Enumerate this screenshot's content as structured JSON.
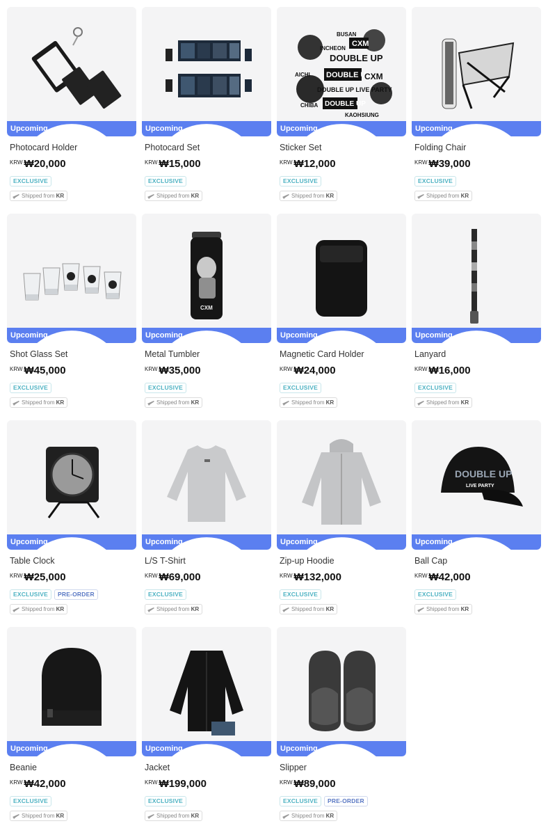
{
  "products": [
    {
      "name": "Photocard Holder",
      "currency": "KRW",
      "price": "₩20,000",
      "status": "Upcoming",
      "tags": [
        "EXCLUSIVE"
      ],
      "shipping_prefix": "Shipped from",
      "shipping_origin": "KR",
      "image": "photocard-holder"
    },
    {
      "name": "Photocard Set",
      "currency": "KRW",
      "price": "₩15,000",
      "status": "Upcoming",
      "tags": [
        "EXCLUSIVE"
      ],
      "shipping_prefix": "Shipped from",
      "shipping_origin": "KR",
      "image": "photocard-set"
    },
    {
      "name": "Sticker Set",
      "currency": "KRW",
      "price": "₩12,000",
      "status": "Upcoming",
      "tags": [
        "EXCLUSIVE"
      ],
      "shipping_prefix": "Shipped from",
      "shipping_origin": "KR",
      "image": "sticker-set"
    },
    {
      "name": "Folding Chair",
      "currency": "KRW",
      "price": "₩39,000",
      "status": "Upcoming",
      "tags": [
        "EXCLUSIVE"
      ],
      "shipping_prefix": "Shipped from",
      "shipping_origin": "KR",
      "image": "folding-chair"
    },
    {
      "name": "Shot Glass Set",
      "currency": "KRW",
      "price": "₩45,000",
      "status": "Upcoming",
      "tags": [
        "EXCLUSIVE"
      ],
      "shipping_prefix": "Shipped from",
      "shipping_origin": "KR",
      "image": "shot-glass-set"
    },
    {
      "name": "Metal Tumbler",
      "currency": "KRW",
      "price": "₩35,000",
      "status": "Upcoming",
      "tags": [
        "EXCLUSIVE"
      ],
      "shipping_prefix": "Shipped from",
      "shipping_origin": "KR",
      "image": "metal-tumbler"
    },
    {
      "name": "Magnetic Card Holder",
      "currency": "KRW",
      "price": "₩24,000",
      "status": "Upcoming",
      "tags": [
        "EXCLUSIVE"
      ],
      "shipping_prefix": "Shipped from",
      "shipping_origin": "KR",
      "image": "magnetic-card-holder"
    },
    {
      "name": "Lanyard",
      "currency": "KRW",
      "price": "₩16,000",
      "status": "Upcoming",
      "tags": [
        "EXCLUSIVE"
      ],
      "shipping_prefix": "Shipped from",
      "shipping_origin": "KR",
      "image": "lanyard"
    },
    {
      "name": "Table Clock",
      "currency": "KRW",
      "price": "₩25,000",
      "status": "Upcoming",
      "tags": [
        "EXCLUSIVE",
        "PRE-ORDER"
      ],
      "shipping_prefix": "Shipped from",
      "shipping_origin": "KR",
      "image": "table-clock"
    },
    {
      "name": "L/S T-Shirt",
      "currency": "KRW",
      "price": "₩69,000",
      "status": "Upcoming",
      "tags": [
        "EXCLUSIVE"
      ],
      "shipping_prefix": "Shipped from",
      "shipping_origin": "KR",
      "image": "ls-tshirt"
    },
    {
      "name": "Zip-up Hoodie",
      "currency": "KRW",
      "price": "₩132,000",
      "status": "Upcoming",
      "tags": [
        "EXCLUSIVE"
      ],
      "shipping_prefix": "Shipped from",
      "shipping_origin": "KR",
      "image": "zip-up-hoodie"
    },
    {
      "name": "Ball Cap",
      "currency": "KRW",
      "price": "₩42,000",
      "status": "Upcoming",
      "tags": [
        "EXCLUSIVE"
      ],
      "shipping_prefix": "Shipped from",
      "shipping_origin": "KR",
      "image": "ball-cap",
      "image_text": [
        "DOUBLE UP",
        "LIVE PARTY"
      ]
    },
    {
      "name": "Beanie",
      "currency": "KRW",
      "price": "₩42,000",
      "status": "Upcoming",
      "tags": [
        "EXCLUSIVE"
      ],
      "shipping_prefix": "Shipped from",
      "shipping_origin": "KR",
      "image": "beanie"
    },
    {
      "name": "Jacket",
      "currency": "KRW",
      "price": "₩199,000",
      "status": "Upcoming",
      "tags": [
        "EXCLUSIVE"
      ],
      "shipping_prefix": "Shipped from",
      "shipping_origin": "KR",
      "image": "jacket"
    },
    {
      "name": "Slipper",
      "currency": "KRW",
      "price": "₩89,000",
      "status": "Upcoming",
      "tags": [
        "EXCLUSIVE",
        "PRE-ORDER"
      ],
      "shipping_prefix": "Shipped from",
      "shipping_origin": "KR",
      "image": "slipper"
    }
  ],
  "sticker_words": [
    "BUSAN",
    "CXM",
    "INCHEON",
    "DOUBLE UP",
    "AICHI",
    "DOUBLE UP",
    "CXM",
    "DOUBLE UP LIVE PARTY",
    "CHIBA",
    "DOUBLE UP",
    "KAOHSIUNG"
  ],
  "colors": {
    "upcoming_bg": "#5b7ff0",
    "exclusive": "#4fb3c3",
    "preorder": "#5a78c4",
    "card_bg": "#f4f4f5"
  },
  "icons": {
    "status": "clock-icon",
    "shipping": "plane-icon"
  }
}
